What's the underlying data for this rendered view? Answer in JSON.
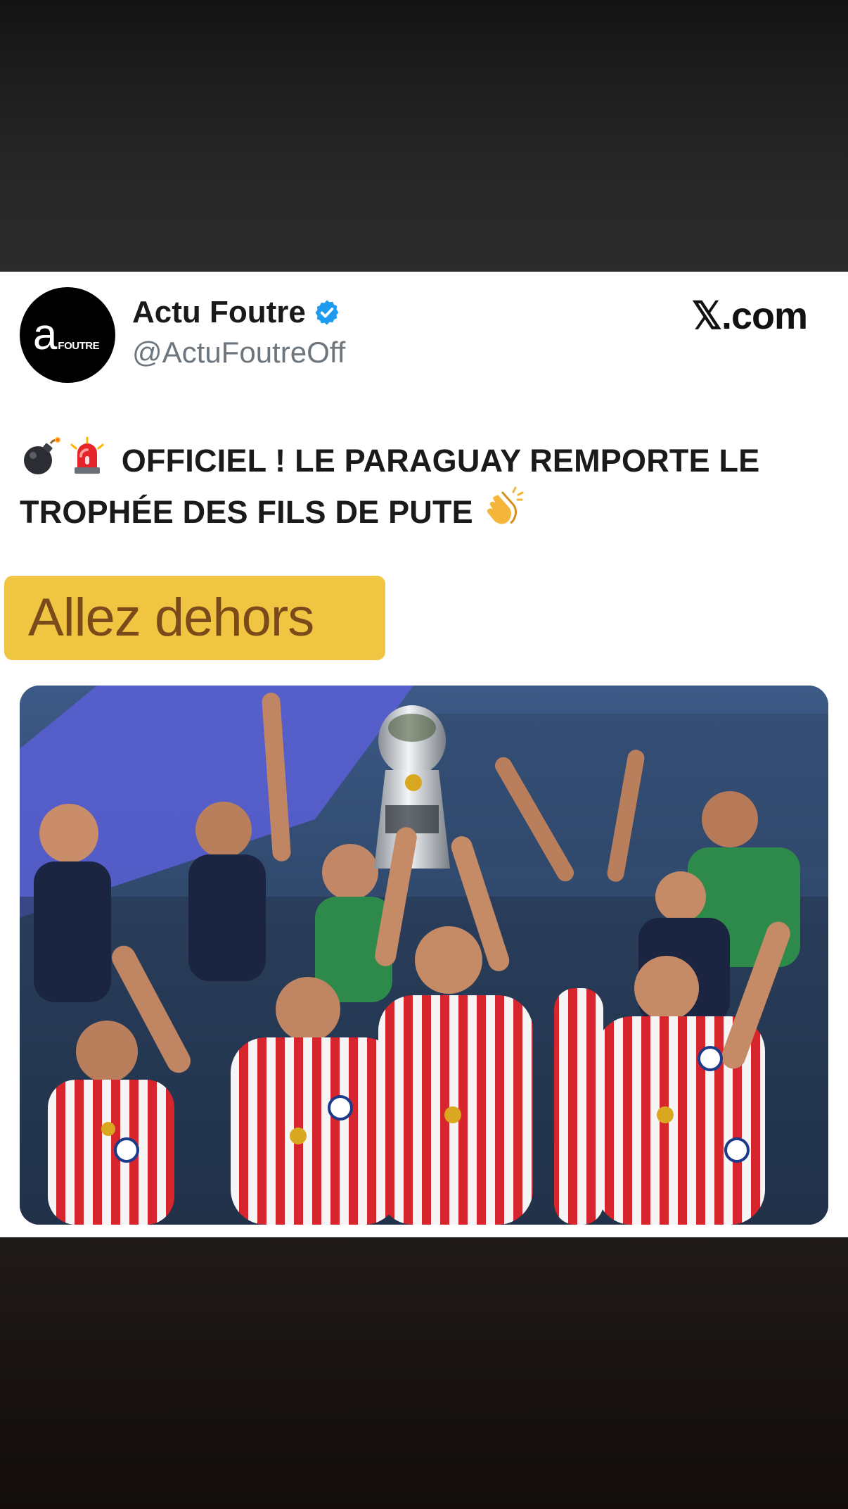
{
  "post": {
    "author": {
      "avatar_text": "a",
      "avatar_word": "FOUTRE",
      "display_name": "Actu Foutre",
      "handle": "@ActuFoutreOff",
      "verified": true
    },
    "source_label": "𝕏.com",
    "text_line_1": "OFFICIEL ! LE PARAGUAY REMPORTE LE",
    "text_line_2": "TROPHÉE DES FILS DE PUTE",
    "emojis": [
      "bomb-icon",
      "siren-icon",
      "clapping-hands-icon"
    ],
    "photo": "paraguay-team-celebrating-with-trophy"
  },
  "overlay_caption": "Allez dehors",
  "colors": {
    "caption_bg": "#f0c541",
    "caption_text": "#7a4a1b",
    "verified_blue": "#1d9bf0",
    "handle_gray": "#6e767d"
  }
}
